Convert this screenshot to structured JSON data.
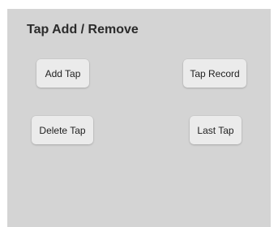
{
  "panel": {
    "title": "Tap Add / Remove",
    "buttons": {
      "add_tap": "Add Tap",
      "tap_record": "Tap Record",
      "delete_tap": "Delete Tap",
      "last_tap": "Last Tap"
    }
  },
  "colors": {
    "panel_background": "#d4d4d4",
    "button_background": "#ebebeb",
    "title_text": "#2b2b2b",
    "button_text": "#1f1f1f"
  }
}
